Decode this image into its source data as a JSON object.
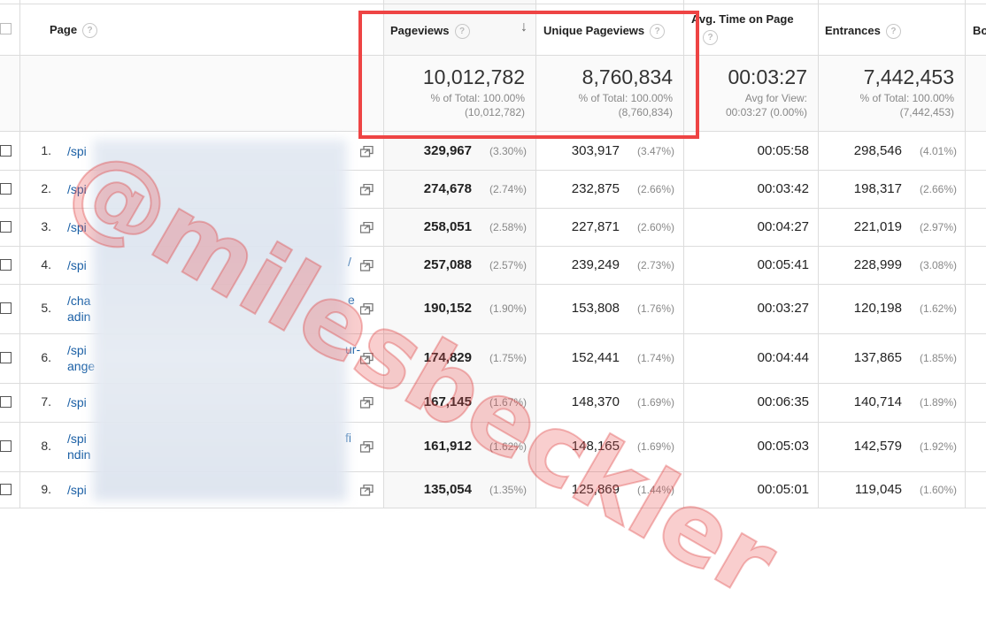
{
  "columns": {
    "page": "Page",
    "pageviews": "Pageviews",
    "unique": "Unique Pageviews",
    "avg_time": "Avg. Time on Page",
    "entrances": "Entrances",
    "bounce": "Bo"
  },
  "help_glyph": "?",
  "sort_arrow": "↓",
  "totals": {
    "pageviews": {
      "value": "10,012,782",
      "line1": "% of Total: 100.00%",
      "line2": "(10,012,782)"
    },
    "unique": {
      "value": "8,760,834",
      "line1": "% of Total: 100.00%",
      "line2": "(8,760,834)"
    },
    "avg_time": {
      "value": "00:03:27",
      "line1": "Avg for View:",
      "line2": "00:03:27 (0.00%)"
    },
    "entrances": {
      "value": "7,442,453",
      "line1": "% of Total: 100.00%",
      "line2": "(7,442,453)"
    }
  },
  "rows": [
    {
      "num": "1.",
      "page1": "/spi",
      "page2": "",
      "pv": "329,967",
      "pv_pct": "(3.30%)",
      "upv": "303,917",
      "upv_pct": "(3.47%)",
      "time": "00:05:58",
      "ent": "298,546",
      "ent_pct": "(4.01%)"
    },
    {
      "num": "2.",
      "page1": "/spi",
      "page2": "",
      "pv": "274,678",
      "pv_pct": "(2.74%)",
      "upv": "232,875",
      "upv_pct": "(2.66%)",
      "time": "00:03:42",
      "ent": "198,317",
      "ent_pct": "(2.66%)"
    },
    {
      "num": "3.",
      "page1": "/spi",
      "page2": "",
      "pv": "258,051",
      "pv_pct": "(2.58%)",
      "upv": "227,871",
      "upv_pct": "(2.60%)",
      "time": "00:04:27",
      "ent": "221,019",
      "ent_pct": "(2.97%)"
    },
    {
      "num": "4.",
      "page1": "/spi",
      "page2": "",
      "tail": "/",
      "pv": "257,088",
      "pv_pct": "(2.57%)",
      "upv": "239,249",
      "upv_pct": "(2.73%)",
      "time": "00:05:41",
      "ent": "228,999",
      "ent_pct": "(3.08%)"
    },
    {
      "num": "5.",
      "page1": "/cha",
      "page2": "adin",
      "tail": "e",
      "pv": "190,152",
      "pv_pct": "(1.90%)",
      "upv": "153,808",
      "upv_pct": "(1.76%)",
      "time": "00:03:27",
      "ent": "120,198",
      "ent_pct": "(1.62%)"
    },
    {
      "num": "6.",
      "page1": "/spi",
      "page2": "ange",
      "tail": "ur-",
      "pv": "174,829",
      "pv_pct": "(1.75%)",
      "upv": "152,441",
      "upv_pct": "(1.74%)",
      "time": "00:04:44",
      "ent": "137,865",
      "ent_pct": "(1.85%)"
    },
    {
      "num": "7.",
      "page1": "/spi",
      "page2": "",
      "pv": "167,145",
      "pv_pct": "(1.67%)",
      "upv": "148,370",
      "upv_pct": "(1.69%)",
      "time": "00:06:35",
      "ent": "140,714",
      "ent_pct": "(1.89%)"
    },
    {
      "num": "8.",
      "page1": "/spi",
      "page2": "ndin",
      "tail": "fi",
      "pv": "161,912",
      "pv_pct": "(1.62%)",
      "upv": "148,165",
      "upv_pct": "(1.69%)",
      "time": "00:05:03",
      "ent": "142,579",
      "ent_pct": "(1.92%)"
    },
    {
      "num": "9.",
      "page1": "/spi",
      "page2": "",
      "pv": "135,054",
      "pv_pct": "(1.35%)",
      "upv": "125,869",
      "upv_pct": "(1.44%)",
      "time": "00:05:01",
      "ent": "119,045",
      "ent_pct": "(1.60%)"
    }
  ],
  "watermark": "@milesbeckler",
  "colors": {
    "link": "#1a5fa5",
    "highlight": "#ee4444",
    "watermark": "#eb5050"
  }
}
